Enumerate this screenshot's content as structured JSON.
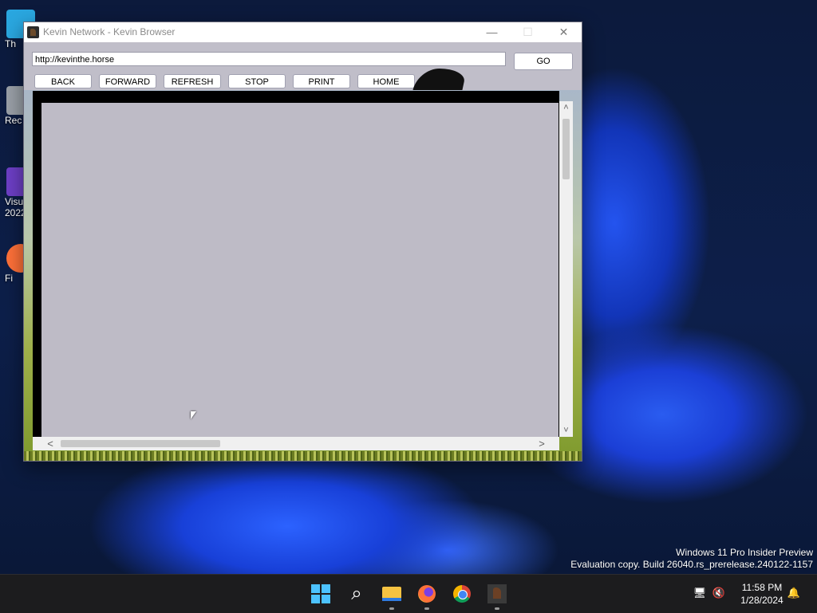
{
  "desktop": {
    "icons": [
      {
        "label": "Th",
        "color": "#2aa7e0"
      },
      {
        "label": "Rec",
        "color": "#9aa0a8"
      },
      {
        "label": "Visu\n2022",
        "color": "#6d3fc6"
      },
      {
        "label": "Fi",
        "color": "#ff7139"
      }
    ],
    "watermark_line1": "Windows 11 Pro Insider Preview",
    "watermark_line2": "Evaluation copy. Build 26040.rs_prerelease.240122-1157"
  },
  "window": {
    "title": "Kevin Network - Kevin Browser",
    "minimize_glyph": "—",
    "maximize_glyph": "☐",
    "close_glyph": "✕"
  },
  "browser": {
    "address_value": "http://kevinthe.horse",
    "go_label": "GO",
    "nav_buttons": {
      "back": "BACK",
      "forward": "FORWARD",
      "refresh": "REFRESH",
      "stop": "STOP",
      "print": "PRINT",
      "home": "HOME"
    },
    "scroll": {
      "up": "˄",
      "down": "˅",
      "left": "<",
      "right": ">"
    }
  },
  "taskbar": {
    "apps": [
      "start-icon",
      "search-icon",
      "file-explorer-icon",
      "firefox-icon",
      "chrome-icon",
      "kevin-browser-icon"
    ],
    "search_glyph": "⌕",
    "time": "11:58 PM",
    "date": "1/28/2024",
    "tray_network_glyph": "🖥",
    "tray_volume_glyph": "🔇",
    "tray_bell_glyph": "🔔"
  }
}
